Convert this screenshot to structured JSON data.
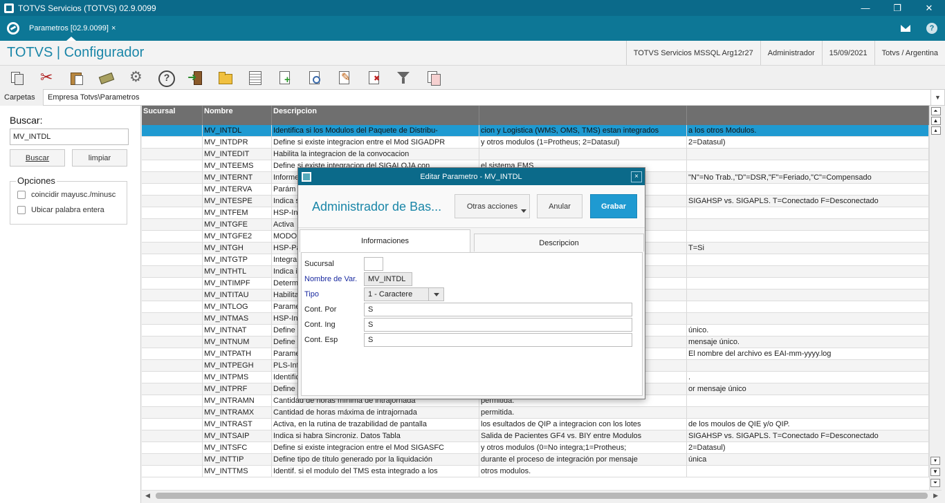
{
  "window": {
    "title": "TOTVS Servicios (TOTVS) 02.9.0099",
    "minimize": "—",
    "restore": "❐",
    "close": "✕"
  },
  "tabbar": {
    "tab_label": "Parametros [02.9.0099]",
    "tab_close": "×"
  },
  "header": {
    "app_title": "TOTVS | Configurador",
    "server": "TOTVS Servicios MSSQL Arg12r27",
    "user": "Administrador",
    "date": "15/09/2021",
    "company": "Totvs / Argentina"
  },
  "toolbar": {
    "icons": [
      "copy-icon",
      "cut-icon",
      "paste-icon",
      "eraser-icon",
      "gear-icon",
      "help-icon",
      "exit-icon",
      "folder-icon",
      "list-icon",
      "new-document-icon",
      "view-document-icon",
      "edit-document-icon",
      "delete-document-icon",
      "filter-icon",
      "documents-icon"
    ]
  },
  "pathbar": {
    "label": "Carpetas",
    "path": "Empresa Totvs\\Parametros",
    "dropdown": "▼"
  },
  "left": {
    "buscar_label": "Buscar:",
    "search_value": "MV_INTDL",
    "buscar_button": "Buscar",
    "limpiar_button": "limpiar",
    "opciones_label": "Opciones",
    "option1": "coincidir mayusc./minusc",
    "option2": "Ubicar palabra entera"
  },
  "grid": {
    "headers": [
      "Sucursal",
      "Nombre",
      "Descripcion",
      "",
      ""
    ],
    "rows": [
      {
        "suc": "",
        "nombre": "MV_INTDL",
        "desc": "Identifica si los Modulos del Paquete de Distribu-",
        "d2": "cion y Logistica (WMS, OMS, TMS) estan integrados",
        "d3": "a los otros Modulos."
      },
      {
        "suc": "",
        "nombre": "MV_INTDPR",
        "desc": "Define si existe integracion entre el Mod SIGADPR",
        "d2": "y otros modulos (1=Protheus; 2=Datasul)",
        "d3": "2=Datasul)"
      },
      {
        "suc": "",
        "nombre": "MV_INTEDIT",
        "desc": "Habilita la integracion de la convocacion",
        "d2": "",
        "d3": ""
      },
      {
        "suc": "",
        "nombre": "MV_INTEEMS",
        "desc": "Define si existe integracion del SIGALOJA con",
        "d2": "el sistema EMS",
        "d3": ""
      },
      {
        "suc": "",
        "nombre": "MV_INTERNT",
        "desc": "Informe",
        "d2": "",
        "d3": "\"N\"=No Trab.,\"D\"=DSR,\"F\"=Feriado,\"C\"=Compensado"
      },
      {
        "suc": "",
        "nombre": "MV_INTERVA",
        "desc": "Parám",
        "d2": "",
        "d3": ""
      },
      {
        "suc": "",
        "nombre": "MV_INTESPE",
        "desc": "Indica s",
        "d2": "os",
        "d3": "SIGAHSP vs. SIGAPLS. T=Conectado F=Desconectado"
      },
      {
        "suc": "",
        "nombre": "MV_INTFEM",
        "desc": "HSP-Int",
        "d2": "",
        "d3": ""
      },
      {
        "suc": "",
        "nombre": "MV_INTGFE",
        "desc": "Activa",
        "d2": "",
        "d3": ""
      },
      {
        "suc": "",
        "nombre": "MV_INTGFE2",
        "desc": "MODO",
        "d2": "",
        "d3": ""
      },
      {
        "suc": "",
        "nombre": "MV_INTGH",
        "desc": "HSP-Pa",
        "d2": "",
        "d3": "T=Si"
      },
      {
        "suc": "",
        "nombre": "MV_INTGTP",
        "desc": " Integra",
        "d2": "",
        "d3": ""
      },
      {
        "suc": "",
        "nombre": "MV_INTHTL",
        "desc": "Indica i",
        "d2": "",
        "d3": ""
      },
      {
        "suc": "",
        "nombre": "MV_INTIMPF",
        "desc": "Determ",
        "d2": "",
        "d3": ""
      },
      {
        "suc": "",
        "nombre": "MV_INTITAU",
        "desc": "Habilita",
        "d2": "",
        "d3": ""
      },
      {
        "suc": "",
        "nombre": "MV_INTLOG",
        "desc": "Parame",
        "d2": "",
        "d3": ""
      },
      {
        "suc": "",
        "nombre": "MV_INTMAS",
        "desc": "HSP-Int",
        "d2": "",
        "d3": ""
      },
      {
        "suc": "",
        "nombre": "MV_INTNAT",
        "desc": "Define",
        "d2": "",
        "d3": "único."
      },
      {
        "suc": "",
        "nombre": "MV_INTNUM",
        "desc": "Define",
        "d2": "r",
        "d3": "mensaje único."
      },
      {
        "suc": "",
        "nombre": "MV_INTPATH",
        "desc": "Parame",
        "d2": "",
        "d3": "El nombre del archivo es EAI-mm-yyyy.log"
      },
      {
        "suc": "",
        "nombre": "MV_INTPEGH",
        "desc": "PLS-Inf",
        "d2": "",
        "d3": ""
      },
      {
        "suc": "",
        "nombre": "MV_INTPMS",
        "desc": "Identific",
        "d2": "",
        "d3": "."
      },
      {
        "suc": "",
        "nombre": "MV_INTPRF",
        "desc": "Define",
        "d2": "p",
        "d3": "or mensaje único"
      },
      {
        "suc": "",
        "nombre": "MV_INTRAMN",
        "desc": "Cantidad de horas mínima de intrajornada",
        "d2": "permitida.",
        "d3": ""
      },
      {
        "suc": "",
        "nombre": "MV_INTRAMX",
        "desc": "Cantidad de horas máxima de intrajornada",
        "d2": "permitida.",
        "d3": ""
      },
      {
        "suc": "",
        "nombre": "MV_INTRAST",
        "desc": "Activa, en la rutina de trazabilidad de pantalla",
        "d2": "los esultados de QIP a integracion con los lotes",
        "d3": "de los moulos de QIE y/o QIP."
      },
      {
        "suc": "",
        "nombre": "MV_INTSAIP",
        "desc": "Indica si habra Sincroniz. Datos Tabla",
        "d2": "Salida de Pacientes GF4 vs. BIY entre Modulos",
        "d3": "SIGAHSP vs. SIGAPLS. T=Conectado F=Desconectado"
      },
      {
        "suc": "",
        "nombre": "MV_INTSFC",
        "desc": "Define si existe integracion entre el Mod SIGASFC",
        "d2": "y otros modulos (0=No integra;1=Protheus;",
        "d3": "2=Datasul)"
      },
      {
        "suc": "",
        "nombre": "MV_INTTIP",
        "desc": "Define tipo de título generado por la liquidación",
        "d2": "durante el proceso de integración por mensaje",
        "d3": "única"
      },
      {
        "suc": "",
        "nombre": "MV_INTTMS",
        "desc": "Identif. si el modulo del TMS esta integrado a los",
        "d2": "otros modulos.",
        "d3": ""
      }
    ]
  },
  "modal": {
    "title": "Editar Parametro - MV_INTDL",
    "close": "×",
    "heading": "Administrador de Bas...",
    "otras_acciones": "Otras acciones",
    "anular": "Anular",
    "grabar": "Grabar",
    "tab_informaciones": "Informaciones",
    "tab_descripcion": "Descripcion",
    "fields": {
      "sucursal_label": "Sucursal",
      "sucursal_value": "",
      "nombre_label": "Nombre de Var.",
      "nombre_value": "MV_INTDL",
      "tipo_label": "Tipo",
      "tipo_value": "1 - Caractere",
      "contpor_label": "Cont. Por",
      "contpor_value": "S",
      "conting_label": "Cont. Ing",
      "conting_value": "S",
      "contesp_label": "Cont. Esp",
      "contesp_value": "S"
    }
  }
}
